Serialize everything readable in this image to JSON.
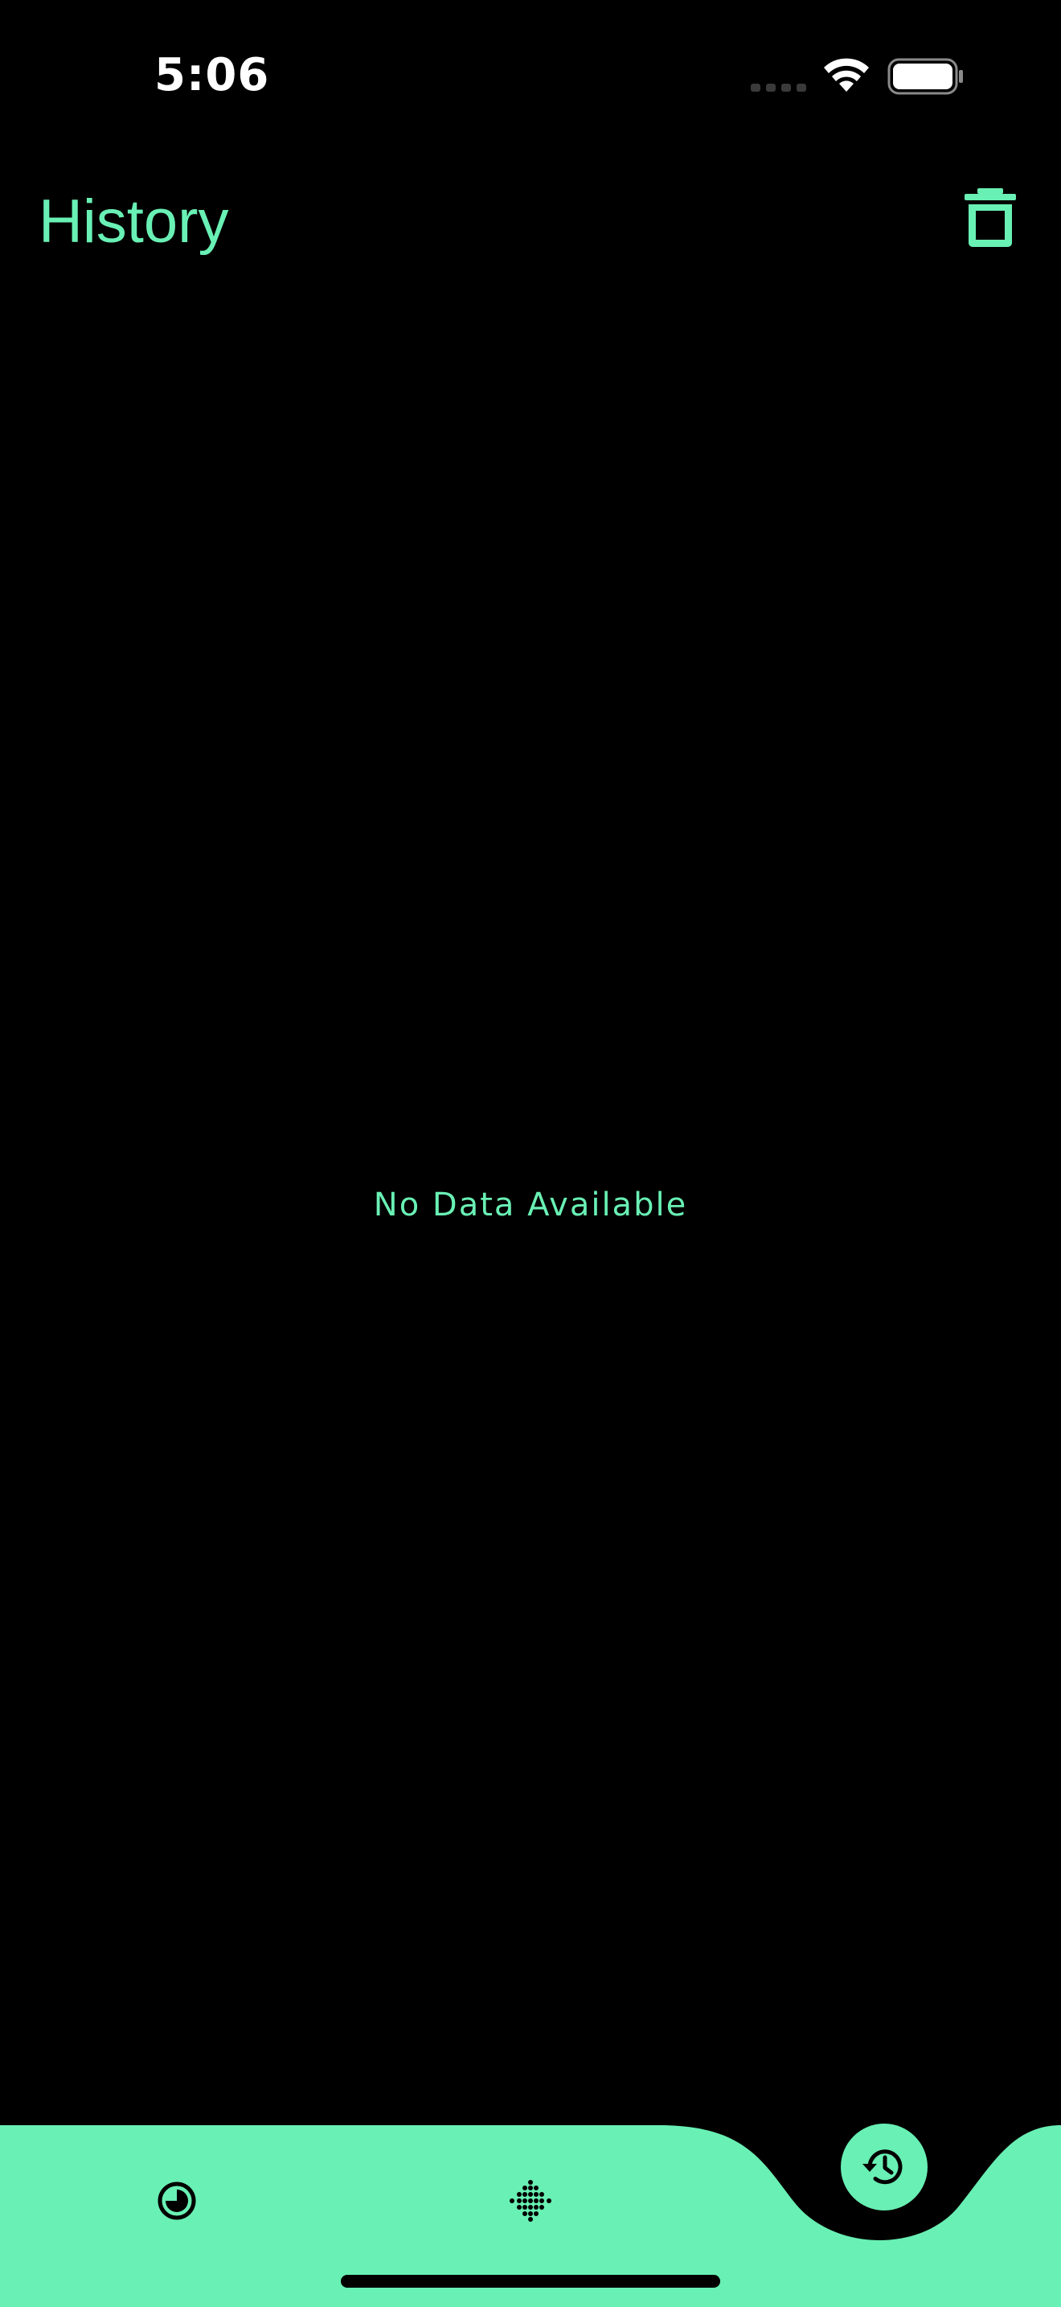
{
  "status_bar": {
    "time": "5:06",
    "signal_icon": "cellular-signal-icon",
    "wifi_icon": "wifi-icon",
    "battery_icon": "battery-icon"
  },
  "header": {
    "title": "History",
    "delete_icon": "trash-icon"
  },
  "main": {
    "empty_message": "No Data Available"
  },
  "tab_bar": {
    "tabs": [
      {
        "icon": "stats-pie-icon",
        "selected": false
      },
      {
        "icon": "scan-dots-icon",
        "selected": false
      },
      {
        "icon": "history-icon",
        "selected": true
      }
    ]
  },
  "colors": {
    "accent": "#69f0b4",
    "background": "#000000",
    "status_text": "#ffffff"
  }
}
